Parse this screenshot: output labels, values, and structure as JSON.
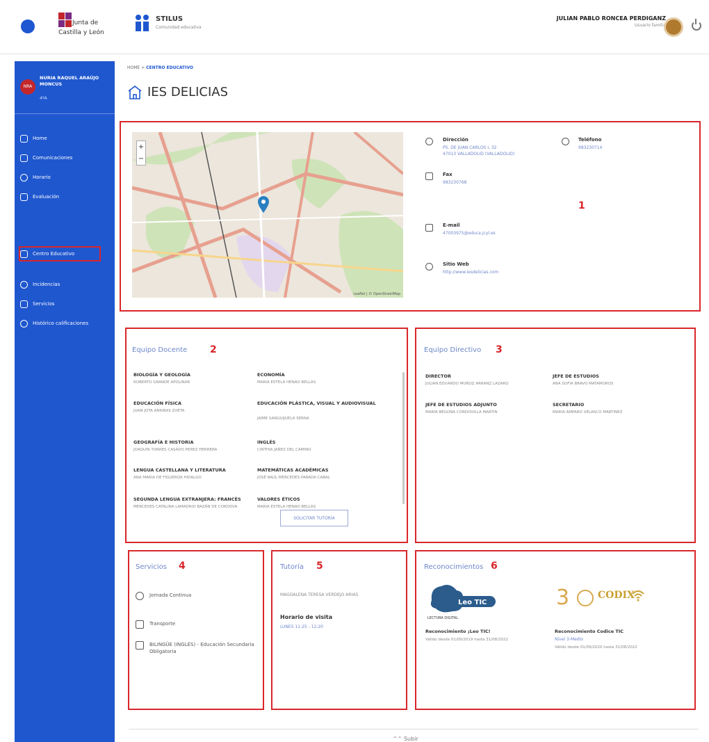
{
  "header": {
    "logo_text_1": "Junta de",
    "logo_text_2": "Castilla y León",
    "app_name": "STILUS",
    "app_subtitle": "Comunidad educativa",
    "user_name": "JULIAN PABLO RONCEA PERDIGANZ",
    "user_role": "Usuario familia"
  },
  "sidebar": {
    "avatar_initials": "NRA",
    "student_name": "NURIA RAQUEL ARAÚJO MONCUS",
    "student_group": "4ºA",
    "items": [
      {
        "label": "Home"
      },
      {
        "label": "Comunicaciones"
      },
      {
        "label": "Horario"
      },
      {
        "label": "Evaluación"
      },
      {
        "label": "Centro Educativo"
      },
      {
        "label": "Incidencias"
      },
      {
        "label": "Servicios"
      },
      {
        "label": "Histórico calificaciones"
      }
    ]
  },
  "breadcrumb": {
    "home": "HOME",
    "separator": ">",
    "current": "CENTRO EDUCATIVO"
  },
  "page": {
    "title": "IES DELICIAS"
  },
  "contact": {
    "number": "1",
    "map_attribution": "Leaflet | © OpenStreetMap",
    "address_label": "Dirección",
    "address_line1": "PS. DE JUAN CARLOS I, 32",
    "address_line2": "47013 VALLADOLID (VALLADOLID)",
    "phone_label": "Teléfono",
    "phone_value": "983230714",
    "fax_label": "Fax",
    "fax_value": "983230768",
    "email_label": "E-mail",
    "email_value": "47003975@educa.jcyl.es",
    "web_label": "Sitio Web",
    "web_value": "http://www.iesdelicias.com"
  },
  "teachers": {
    "title": "Equipo Docente",
    "number": "2",
    "subjects": [
      {
        "name": "BIOLOGÍA Y GEOLOGÍA",
        "teacher": "ROBERTO GRANDE APOLINAR"
      },
      {
        "name": "ECONOMÍA",
        "teacher": "MARIA ESTELA HENAO BELLAS"
      },
      {
        "name": "EDUCACIÓN FÍSICA",
        "teacher": "JUAN JOTA ARRIBAS ZUETA"
      },
      {
        "name": "EDUCACIÓN PLÁSTICA, VISUAL Y AUDIOVISUAL",
        "teacher": "JAIME SANGUIJUELA SERNA"
      },
      {
        "name": "GEOGRAFÍA E HISTORIA",
        "teacher": "JOAQUIN TORRES CASADO PEREZ HERRERA"
      },
      {
        "name": "INGLÉS",
        "teacher": "CINTHIA JAÑEZ DEL CAMINO"
      },
      {
        "name": "LENGUA CASTELLANA Y LITERATURA",
        "teacher": "ANA MARIA DE FIGUEROA HIDALGO"
      },
      {
        "name": "MATEMÁTICAS ACADÉMICAS",
        "teacher": "JOSÉ RAÚL MERCEDES PARADA CABAL"
      },
      {
        "name": "SEGUNDA LENGUA EXTRANJERA: FRANCÉS",
        "teacher": "MERCEDES CATALINA LAMADRID BAZÁN DE CORDOVA"
      },
      {
        "name": "VALORES ÉTICOS",
        "teacher": "MARIA ESTELA HENAO BELLAS"
      }
    ]
  },
  "management": {
    "title": "Equipo Directivo",
    "number": "3",
    "roles": [
      {
        "role": "DIRECTOR",
        "person": "JULIAN EDUARDO MUÑOZ ARRANZ LAZARO"
      },
      {
        "role": "JEFE DE ESTUDIOS",
        "person": "ANA SOFIA BRAVO MATAMOROS"
      },
      {
        "role": "JEFE DE ESTUDIOS ADJUNTO",
        "person": "MARÍA BEGOÑA CORDOVILLA MARTIN"
      },
      {
        "role": "SECRETARIO",
        "person": "MARIA AMPARO VELASCO MARTINEZ"
      }
    ]
  },
  "services": {
    "title": "Servicios",
    "number": "4",
    "items": [
      {
        "label": "Jornada Continua",
        "icon": "clock-icon"
      },
      {
        "label": "Transporte",
        "icon": "bus-icon"
      },
      {
        "label": "BILINGÜE (INGLÉS) - Educación Secundaria Obligatoria",
        "icon": "flag-icon"
      }
    ]
  },
  "tutoring": {
    "title": "Tutoría",
    "number": "5",
    "tutor": "MAGDALENA TERESA VERDEJO ARIAS",
    "schedule_label": "Horario de visita",
    "schedule_value": "LUNES 11:25 - 12:20",
    "button_label": "SOLICITAR TUTORÍA"
  },
  "recognitions": {
    "title": "Reconocimientos",
    "number": "6",
    "items": [
      {
        "name": "Reconocimiento ¡Leo TIC!",
        "level": "",
        "validity": "Válido desde 01/09/2019 hasta 31/08/2022"
      },
      {
        "name": "Reconocimiento Codice TIC",
        "level": "Nivel 3-Medio",
        "validity": "Válido desde 01/09/2020 hasta 31/08/2022"
      }
    ],
    "leo_badge_text": "LECTURA DIGITAL",
    "codix_number": "3",
    "codix_text": "CODIX"
  },
  "footer": {
    "text": "⌃⌃ Subir"
  }
}
